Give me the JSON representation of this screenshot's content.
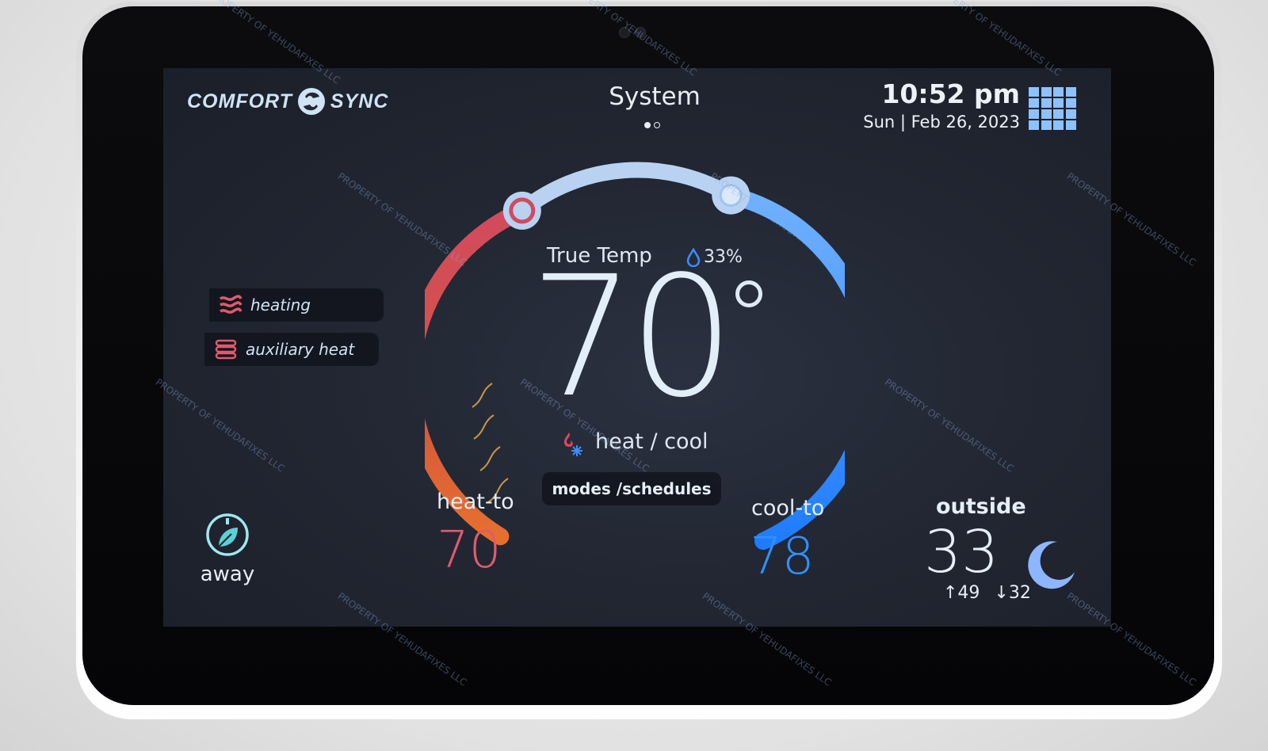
{
  "brand": {
    "left": "COMFORT",
    "right": "SYNC"
  },
  "header": {
    "title": "System",
    "page_dots": 2,
    "active_dot": 0
  },
  "clock": {
    "time": "10:52 pm",
    "date": "Sun | Feb 26, 2023"
  },
  "status_items": [
    {
      "label": "heating",
      "icon": "heating-waves-icon"
    },
    {
      "label": "auxiliary heat",
      "icon": "auxiliary-heat-coil-icon"
    }
  ],
  "dial": {
    "label": "True Temp",
    "humidity": "33%",
    "temperature": "70",
    "mode": "heat / cool",
    "heat_color": "#e05a6e",
    "cool_color": "#2f8cff",
    "arc_color": "#b9d2f1"
  },
  "modes_button": "modes /schedules",
  "heat_to": {
    "label": "heat-to",
    "value": "70"
  },
  "cool_to": {
    "label": "cool-to",
    "value": "78"
  },
  "away": {
    "label": "away"
  },
  "outside": {
    "label": "outside",
    "temp": "33",
    "high": "↑49",
    "low": "↓32"
  },
  "watermark": "PROPERTY OF YEHUDAFIXES LLC"
}
